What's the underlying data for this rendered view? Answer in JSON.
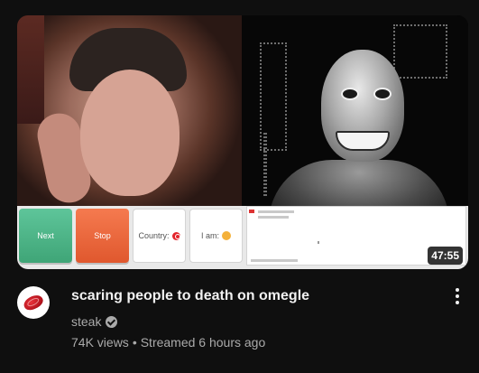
{
  "video": {
    "duration": "47:55",
    "title": "scaring people to death on omegle",
    "channel": "steak",
    "views": "74K views",
    "separator": "•",
    "streamed": "Streamed 6 hours ago"
  },
  "thumbnail_ui": {
    "next_label": "Next",
    "stop_label": "Stop",
    "country_label": "Country:",
    "iam_label": "I am:"
  },
  "icons": {
    "avatar": "steak-icon",
    "verified": "verified-check-icon",
    "menu": "more-vert-icon"
  },
  "colors": {
    "background": "#0f0f0f",
    "title": "#f1f1f1",
    "secondary": "#aaaaaa",
    "next_button": "#4cb686",
    "stop_button": "#ec6a3f"
  }
}
